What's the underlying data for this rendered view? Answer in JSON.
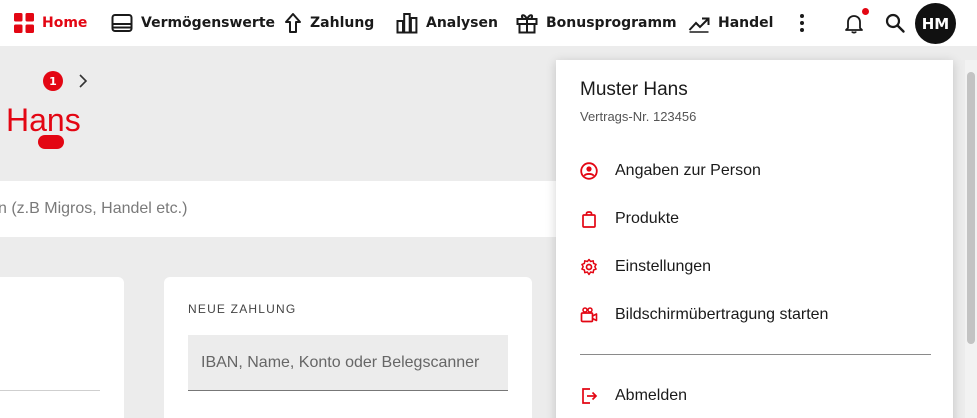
{
  "nav": {
    "home": "Home",
    "assets": "Vermögenswerte",
    "payment": "Zahlung",
    "analysis": "Analysen",
    "bonus": "Bonusprogramm",
    "trade": "Handel",
    "avatar_initials": "HM"
  },
  "page": {
    "greeting": "Hans",
    "search_placeholder": "n (z.B Migros, Handel etc.)",
    "badge_count": "1",
    "new_payment_label": "NEUE ZAHLUNG",
    "payment_input_placeholder": "IBAN, Name, Konto oder Belegscanner"
  },
  "menu": {
    "user_name": "Muster Hans",
    "contract": "Vertrags-Nr. 123456",
    "items": [
      {
        "label": "Angaben zur Person",
        "icon": "person-circle-icon"
      },
      {
        "label": "Produkte",
        "icon": "shopping-bag-icon"
      },
      {
        "label": "Einstellungen",
        "icon": "gear-icon"
      },
      {
        "label": "Bildschirmübertragung starten",
        "icon": "video-camera-icon"
      }
    ],
    "logout": "Abmelden"
  },
  "colors": {
    "accent": "#e30613",
    "background": "#ececec",
    "text": "#1a1a1a"
  }
}
